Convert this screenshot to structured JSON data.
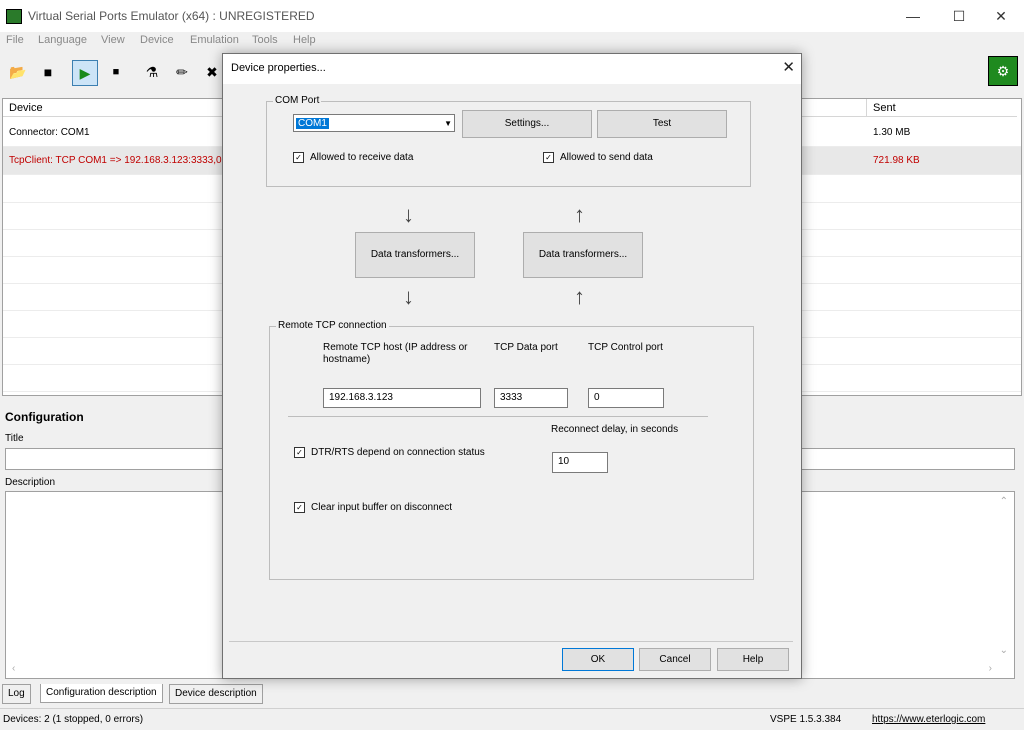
{
  "window": {
    "title": "Virtual Serial Ports Emulator (x64) : UNREGISTERED"
  },
  "menu": [
    "File",
    "Language",
    "View",
    "Device",
    "Emulation",
    "Tools",
    "Help"
  ],
  "table": {
    "col_device": "Device",
    "col_sent": "Sent",
    "rows": [
      {
        "device": "Connector: COM1",
        "sent": "1.30 MB"
      },
      {
        "device": "TcpClient: TCP COM1 => 192.168.3.123:3333,0",
        "sent": "721.98 KB"
      }
    ]
  },
  "config": {
    "heading": "Configuration",
    "title_label": "Title",
    "title_value": "",
    "description_label": "Description"
  },
  "tabs": [
    "Log",
    "Configuration description",
    "Device description"
  ],
  "status": {
    "devices": "Devices: 2 (1 stopped, 0 errors)",
    "version": "VSPE 1.5.3.384",
    "url": "https://www.eterlogic.com"
  },
  "dialog": {
    "title": "Device properties...",
    "com_group": "COM Port",
    "com_value": "COM1",
    "settings_btn": "Settings...",
    "test_btn": "Test",
    "recv_chk": "Allowed to receive data",
    "send_chk": "Allowed to send data",
    "transformers_left": "Data transformers...",
    "transformers_right": "Data transformers...",
    "tcp_group": "Remote TCP connection",
    "host_label": "Remote TCP host (IP address or hostname)",
    "data_port_label": "TCP Data port",
    "control_port_label": "TCP Control port",
    "host_value": "192.168.3.123",
    "data_port_value": "3333",
    "control_port_value": "0",
    "reconnect_label": "Reconnect delay, in seconds",
    "reconnect_value": "10",
    "dtr_chk": "DTR/RTS depend on connection status",
    "clear_chk": "Clear input buffer on disconnect",
    "ok_btn": "OK",
    "cancel_btn": "Cancel",
    "help_btn": "Help"
  }
}
